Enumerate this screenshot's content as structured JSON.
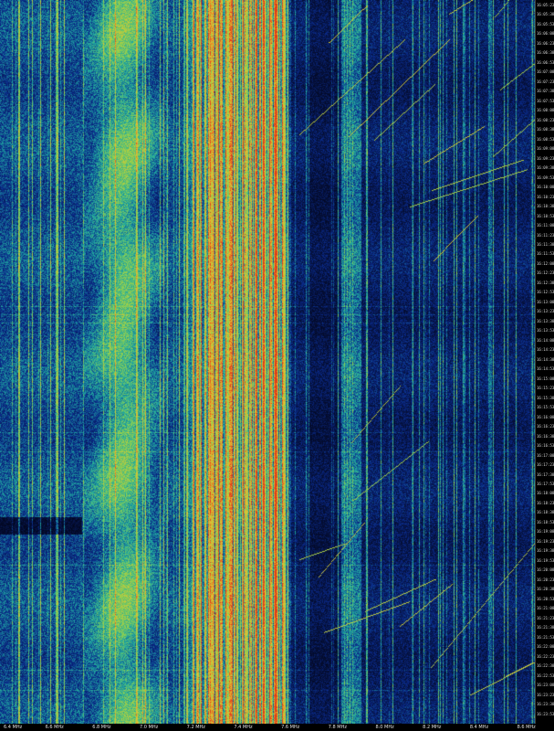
{
  "waterfall": {
    "frequency_labels": [
      "6.4 MHz",
      "6.6 MHz",
      "6.8 MHz",
      "7.0 MHz",
      "7.2 MHz",
      "7.4 MHz",
      "7.6 MHz",
      "7.8 MHz",
      "8.0 MHz",
      "8.2 MHz",
      "8.4 MHz",
      "8.6 MHz"
    ],
    "time_labels": [
      "16:05:23",
      "16:05:38",
      "16:05:53",
      "16:06:08",
      "16:06:23",
      "16:06:38",
      "16:06:53",
      "16:07:08",
      "16:07:23",
      "16:07:38",
      "16:07:53",
      "16:08:08",
      "16:08:23",
      "16:08:38",
      "16:08:53",
      "16:09:08",
      "16:09:23",
      "16:09:38",
      "16:09:53",
      "16:10:08",
      "16:10:23",
      "16:10:38",
      "16:10:53",
      "16:11:08",
      "16:11:23",
      "16:11:38",
      "16:11:53",
      "16:12:08",
      "16:12:23",
      "16:12:38",
      "16:12:53",
      "16:13:08",
      "16:13:23",
      "16:13:38",
      "16:13:53",
      "16:14:08",
      "16:14:23",
      "16:14:38",
      "16:14:53",
      "16:15:08",
      "16:15:23",
      "16:15:38",
      "16:15:53",
      "16:16:08",
      "16:16:23",
      "16:16:38",
      "16:16:53",
      "16:17:08",
      "16:17:23",
      "16:17:38",
      "16:17:53",
      "16:18:08",
      "16:18:23",
      "16:18:38",
      "16:18:53",
      "16:19:08",
      "16:19:23",
      "16:19:38",
      "16:19:53",
      "16:20:08",
      "16:20:23",
      "16:20:38",
      "16:20:53",
      "16:21:08",
      "16:21:23",
      "16:21:38",
      "16:21:53",
      "16:22:08",
      "16:22:23",
      "16:22:38",
      "16:22:53",
      "16:23:08",
      "16:23:23",
      "16:23:38",
      "16:23:53"
    ],
    "colors": {
      "noise_floor": "#0a2a8a",
      "quiet_band": "#05103a",
      "weak_signal": "#1fa8a0",
      "moderate_signal": "#8fd14f",
      "strong_signal": "#e8c030",
      "peak_signal": "#e03a1a"
    }
  }
}
